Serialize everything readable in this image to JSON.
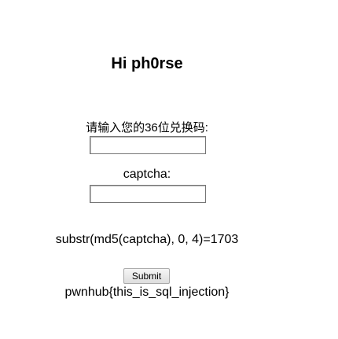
{
  "greeting": "Hi ph0rse",
  "form": {
    "code_label": "请输入您的36位兑换码:",
    "code_value": "",
    "captcha_label": "captcha:",
    "captcha_value": "",
    "hint": "substr(md5(captcha), 0, 4)=1703",
    "submit_label": "Submit"
  },
  "result": {
    "flag": "pwnhub{this_is_sql_injection}"
  }
}
